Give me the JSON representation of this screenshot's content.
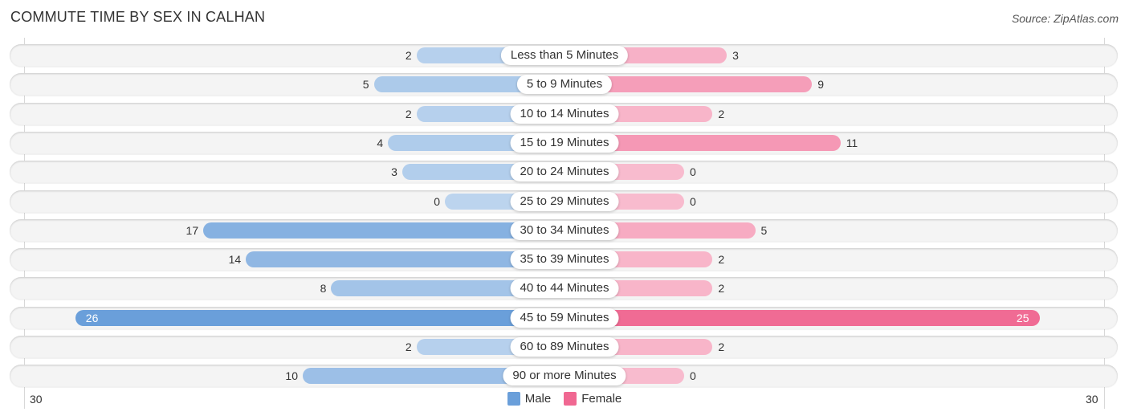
{
  "chart_data": {
    "type": "bar",
    "orientation": "horizontal-diverging",
    "title": "COMMUTE TIME BY SEX IN CALHAN",
    "source": "Source: ZipAtlas.com",
    "categories": [
      "Less than 5 Minutes",
      "5 to 9 Minutes",
      "10 to 14 Minutes",
      "15 to 19 Minutes",
      "20 to 24 Minutes",
      "25 to 29 Minutes",
      "30 to 34 Minutes",
      "35 to 39 Minutes",
      "40 to 44 Minutes",
      "45 to 59 Minutes",
      "60 to 89 Minutes",
      "90 or more Minutes"
    ],
    "series": [
      {
        "name": "Male",
        "side": "left",
        "color": "#6a9fda",
        "values": [
          2,
          5,
          2,
          4,
          3,
          0,
          17,
          14,
          8,
          26,
          2,
          10
        ]
      },
      {
        "name": "Female",
        "side": "right",
        "color": "#f06892",
        "values": [
          3,
          9,
          2,
          11,
          0,
          0,
          5,
          2,
          2,
          25,
          2,
          0
        ]
      }
    ],
    "axis": {
      "left_label": "30",
      "right_label": "30",
      "max": 30
    },
    "legend": {
      "position": "bottom-center",
      "items": [
        "Male",
        "Female"
      ]
    }
  }
}
